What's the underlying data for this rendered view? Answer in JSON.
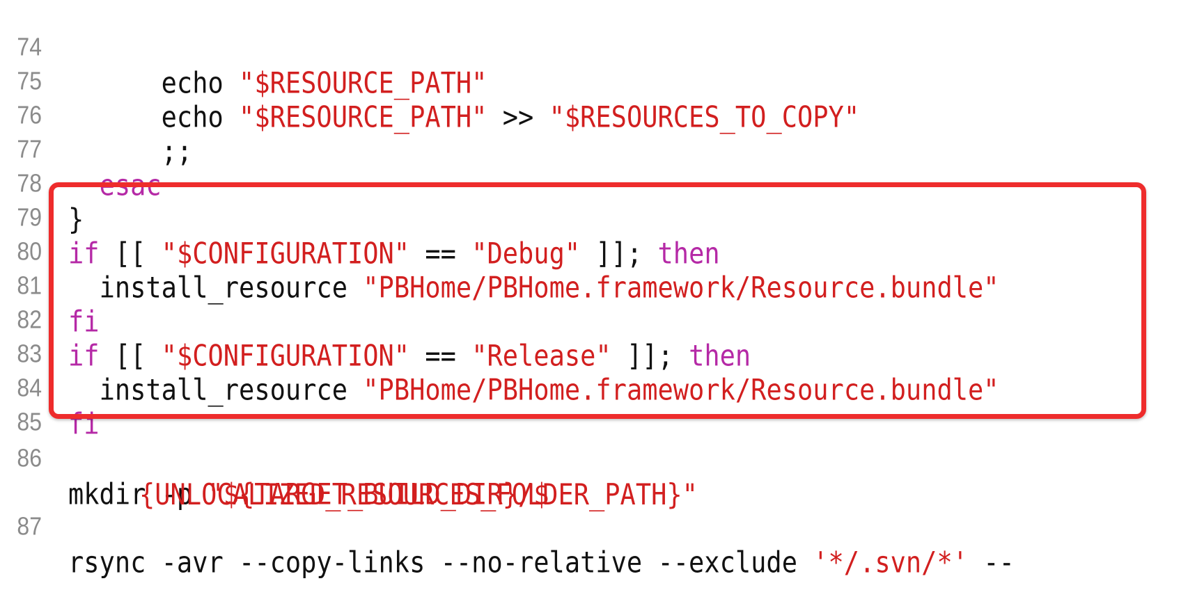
{
  "accent_color": "#ee2c2c",
  "colors": {
    "keyword": "#b529a6",
    "string": "#d21f1f",
    "plain": "#111111",
    "line_number": "#8b8b8b"
  },
  "lines": {
    "l74": {
      "num": "74",
      "indent": "      ",
      "t1": "echo ",
      "t2": "\"$RESOURCE_PATH\""
    },
    "l75": {
      "num": "75",
      "indent": "      ",
      "t1": "echo ",
      "t2": "\"$RESOURCE_PATH\"",
      "t3": " >> ",
      "t4": "\"$RESOURCES_TO_COPY\""
    },
    "l76": {
      "num": "76",
      "indent": "      ",
      "t1": ";;"
    },
    "l77": {
      "num": "77",
      "indent": "  ",
      "t1": "esac"
    },
    "l78": {
      "num": "78",
      "t1": "}"
    },
    "l79": {
      "num": "79",
      "t1": "if",
      "t2": " [[ ",
      "t3": "\"$CONFIGURATION\"",
      "t4": " == ",
      "t5": "\"Debug\"",
      "t6": " ]]; ",
      "t7": "then"
    },
    "l80": {
      "num": "80",
      "indent": "  ",
      "t1": "install_resource ",
      "t2": "\"PBHome/PBHome.framework/Resource.bundle\""
    },
    "l81": {
      "num": "81",
      "t1": "fi"
    },
    "l82": {
      "num": "82",
      "t1": "if",
      "t2": " [[ ",
      "t3": "\"$CONFIGURATION\"",
      "t4": " == ",
      "t5": "\"Release\"",
      "t6": " ]]; ",
      "t7": "then"
    },
    "l83": {
      "num": "83",
      "indent": "  ",
      "t1": "install_resource ",
      "t2": "\"PBHome/PBHome.framework/Resource.bundle\""
    },
    "l84": {
      "num": "84",
      "t1": "fi"
    },
    "l85": {
      "num": "85"
    },
    "l86": {
      "num": "86",
      "t1": "mkdir -p ",
      "t2": "\"${TARGET_BUILD_DIR}/$"
    },
    "l86b": {
      "t2": "{UNLOCALIZED_RESOURCES_FOLDER_PATH}\""
    },
    "l87": {
      "num": "87",
      "t1": "rsync -avr --copy-links --no-relative --exclude ",
      "t2": "'*/.svn/*'",
      "t3": " --"
    }
  }
}
